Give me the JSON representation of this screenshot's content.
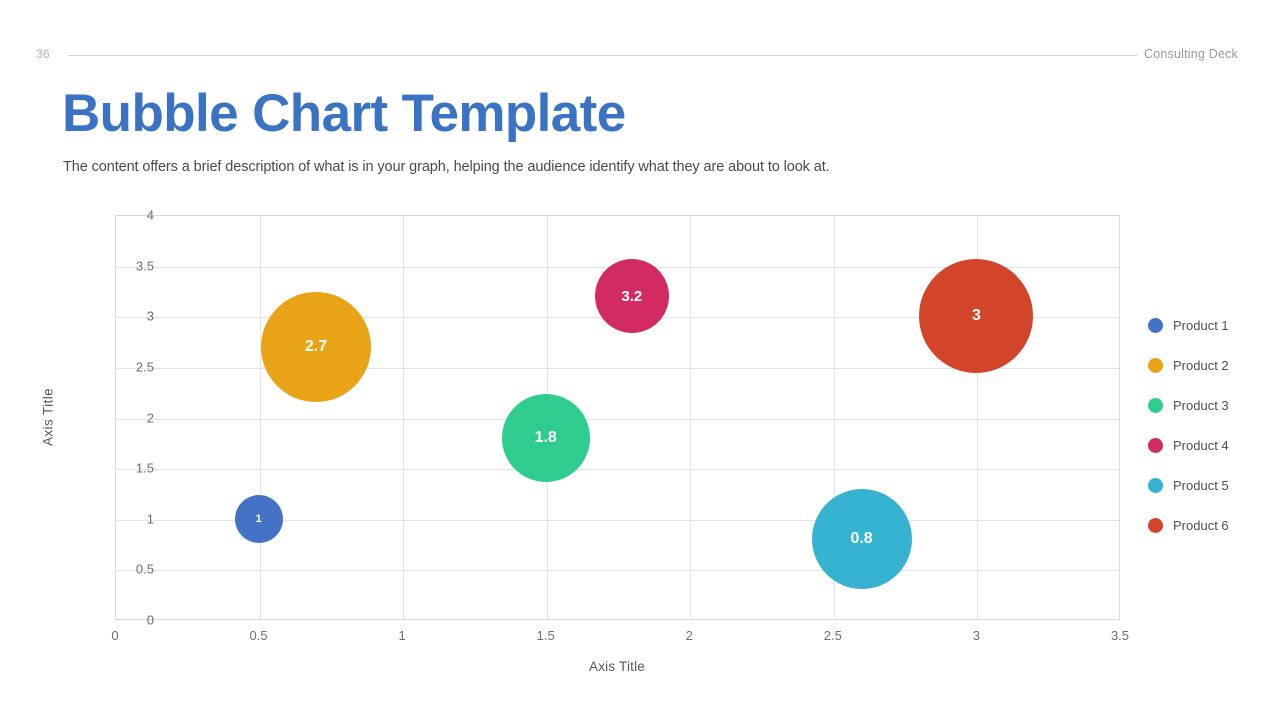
{
  "header": {
    "page_number": "36",
    "deck_name": "Consulting Deck"
  },
  "title": "Bubble Chart Template",
  "subtitle": "The content offers a brief description of what is in your graph, helping the audience identify what they are about to look at.",
  "legend": {
    "items": [
      {
        "label": "Product 1",
        "color": "#4472C4"
      },
      {
        "label": "Product 2",
        "color": "#E8A317"
      },
      {
        "label": "Product 3",
        "color": "#2ECC8F"
      },
      {
        "label": "Product 4",
        "color": "#D32A63"
      },
      {
        "label": "Product 5",
        "color": "#35B3D0"
      },
      {
        "label": "Product 6",
        "color": "#D2452B"
      }
    ]
  },
  "chart_data": {
    "type": "scatter",
    "title": "",
    "xlabel": "Axis Title",
    "ylabel": "Axis Title",
    "xlim": [
      0,
      3.5
    ],
    "ylim": [
      0,
      4
    ],
    "xticks": [
      "0",
      "0.5",
      "1",
      "1.5",
      "2",
      "2.5",
      "3",
      "3.5"
    ],
    "yticks": [
      "0",
      "0.5",
      "1",
      "1.5",
      "2",
      "2.5",
      "3",
      "3.5",
      "4"
    ],
    "grid": true,
    "legend_position": "right",
    "series": [
      {
        "name": "Product 1",
        "x": 0.5,
        "y": 1.0,
        "size": 1.0,
        "label": "1",
        "color": "#4472C4",
        "radius_px": 24
      },
      {
        "name": "Product 2",
        "x": 0.7,
        "y": 2.7,
        "size": 2.7,
        "label": "2.7",
        "color": "#E8A317",
        "radius_px": 55
      },
      {
        "name": "Product 3",
        "x": 1.5,
        "y": 1.8,
        "size": 1.8,
        "label": "1.8",
        "color": "#2ECC8F",
        "radius_px": 44
      },
      {
        "name": "Product 4",
        "x": 1.8,
        "y": 3.2,
        "size": 3.2,
        "label": "3.2",
        "color": "#D32A63",
        "radius_px": 37
      },
      {
        "name": "Product 5",
        "x": 2.6,
        "y": 0.8,
        "size": 0.8,
        "label": "0.8",
        "color": "#35B3D0",
        "radius_px": 50
      },
      {
        "name": "Product 6",
        "x": 3.0,
        "y": 3.0,
        "size": 3.0,
        "label": "3",
        "color": "#D2452B",
        "radius_px": 57
      }
    ]
  }
}
